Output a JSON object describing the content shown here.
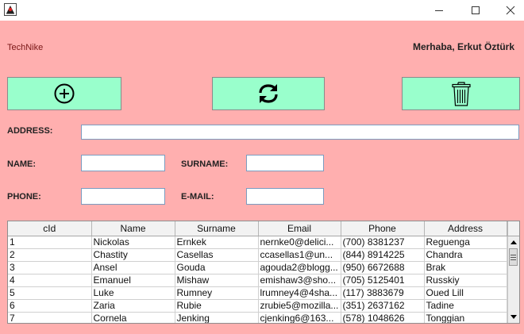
{
  "window": {
    "app_icon": "java-duke-icon",
    "controls": [
      "minimize-icon",
      "maximize-icon",
      "close-icon"
    ]
  },
  "header": {
    "brand": "TechNike",
    "greeting": "Merhaba, Erkut Öztürk"
  },
  "toolbar": {
    "add_icon": "circle-plus-icon",
    "refresh_icon": "refresh-icon",
    "delete_icon": "trash-icon",
    "button_color": "#99ffcc"
  },
  "form": {
    "address_label": "ADDRESS:",
    "name_label": "NAME:",
    "surname_label": "SURNAME:",
    "phone_label": "PHONE:",
    "email_label": "E-MAIL:",
    "address_value": "",
    "name_value": "",
    "surname_value": "",
    "phone_value": "",
    "email_value": ""
  },
  "colors": {
    "background": "#ffafaf",
    "button": "#99ffcc"
  },
  "table": {
    "columns": [
      "cId",
      "Name",
      "Surname",
      "Email",
      "Phone",
      "Address"
    ],
    "rows": [
      [
        "1",
        "Nickolas",
        "Ernkek",
        "nernke0@delici...",
        "(700) 8381237",
        "Reguenga"
      ],
      [
        "2",
        "Chastity",
        "Casellas",
        "ccasellas1@un...",
        "(844) 8914225",
        "Chandra"
      ],
      [
        "3",
        "Ansel",
        "Gouda",
        "agouda2@blogg...",
        "(950) 6672688",
        "Brak"
      ],
      [
        "4",
        "Emanuel",
        "Mishaw",
        "emishaw3@sho...",
        "(705) 5125401",
        "Russkiy"
      ],
      [
        "5",
        "Luke",
        "Rumney",
        "lrumney4@4sha...",
        "(117) 3883679",
        "Oued Lill"
      ],
      [
        "6",
        "Zaria",
        "Rubie",
        "zrubie5@mozilla...",
        "(351) 2637162",
        "Tadine"
      ],
      [
        "7",
        "Cornela",
        "Jenking",
        "cjenking6@163...",
        "(578) 1048626",
        "Tonggian"
      ]
    ]
  }
}
